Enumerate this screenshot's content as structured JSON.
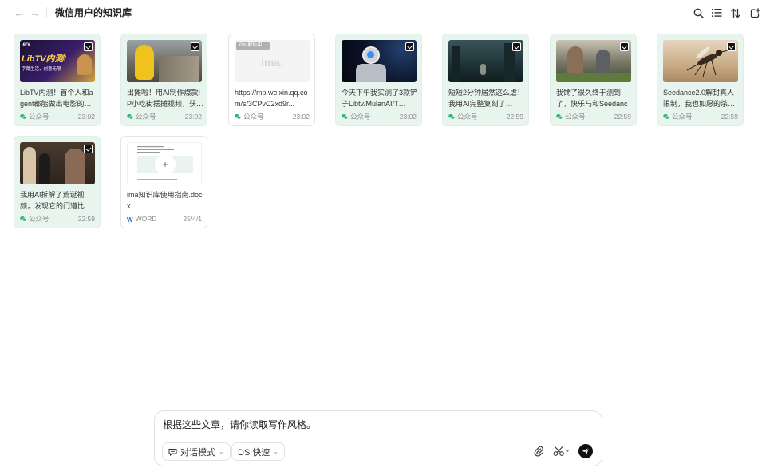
{
  "header": {
    "title": "微信用户的知识库"
  },
  "cards": [
    {
      "title": "LibTV内测！首个人和agent都能做出电影的…",
      "source": "公众号",
      "time": "23:02",
      "thumb_text": "LibTV内测!",
      "thumb_sub": "字幕生活，创意无限"
    },
    {
      "title": "出摊啦！用AI制作爆款IP小吃街摆摊视频，获…",
      "source": "公众号",
      "time": "23:02"
    },
    {
      "title": "https://mp.weixin.qq.com/s/3CPvC2xd9r...",
      "source": "公众号",
      "time": "23:02",
      "progress_text": "0%  解析中…",
      "progress": 0,
      "thumb_logo": "ima."
    },
    {
      "title": "今天下午我实测了3款铲子Libtv/MulanAI/T…",
      "source": "公众号",
      "time": "23:02"
    },
    {
      "title": "短短2分钟居然这么虐！我用AI完整复刻了…",
      "source": "公众号",
      "time": "22:59"
    },
    {
      "title": "我馋了很久终于测到了，快乐马和Seedance…",
      "source": "公众号",
      "time": "22:59"
    },
    {
      "title": "Seedance2.0解封真人限制，我也如愿的杀…",
      "source": "公众号",
      "time": "22:59"
    },
    {
      "title": "我用AI拆解了荒诞视频，发现它的门道比我…",
      "source": "公众号",
      "time": "22:59"
    },
    {
      "title": "ima知识库使用指南.docx",
      "source": "WORD",
      "time": "25/4/1"
    }
  ],
  "composer": {
    "prompt": "根据这些文章，请你读取写作风格。",
    "mode_label": "对话模式",
    "model_label": "DS 快速"
  },
  "colors": {
    "selected_card_bg": "#e8f5ee",
    "wechat_green": "#2bb673",
    "word_blue": "#2b6fd6"
  }
}
